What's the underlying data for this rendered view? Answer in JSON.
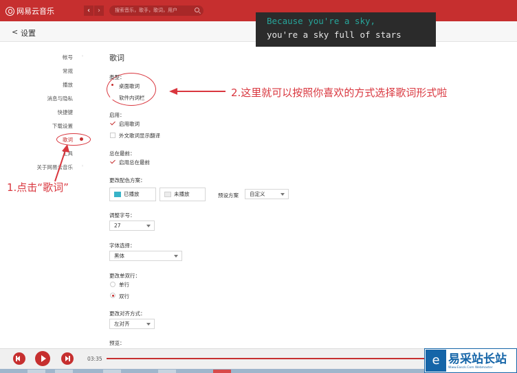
{
  "app": {
    "name": "网易云音乐",
    "search_placeholder": "搜索音乐，歌手，歌词，用户"
  },
  "overlay_lyrics": {
    "line1": "Because you're a sky,",
    "line2": "you're a sky full of stars"
  },
  "header": {
    "back_glyph": "<",
    "title": "设置"
  },
  "sidebar": {
    "items": [
      {
        "label": "帐号",
        "selected": false
      },
      {
        "label": "常规",
        "selected": false
      },
      {
        "label": "播放",
        "selected": false
      },
      {
        "label": "消息与隐私",
        "selected": false
      },
      {
        "label": "快捷键",
        "selected": false
      },
      {
        "label": "下载设置",
        "selected": false
      },
      {
        "label": "歌词",
        "selected": true
      },
      {
        "label": "工具",
        "selected": false
      },
      {
        "label": "关于网易云音乐",
        "selected": false
      }
    ]
  },
  "lyrics_settings": {
    "heading": "歌词",
    "type": {
      "label": "类型：",
      "options": [
        {
          "label": "桌面歌词",
          "selected": true
        },
        {
          "label": "软件内词栏",
          "selected": false
        }
      ]
    },
    "enable": {
      "label": "启用：",
      "options": [
        {
          "label": "启用歌词",
          "checked": true
        },
        {
          "label": "外文歌词显示翻译",
          "checked": false
        }
      ]
    },
    "always_on_top": {
      "label": "总在最前：",
      "option": {
        "label": "启用总在最前",
        "checked": true
      }
    },
    "color_scheme": {
      "label": "更改配色方案：",
      "played": "已播放",
      "unplayed": "未播放",
      "preset_label": "预设方案",
      "preset_value": "自定义",
      "played_color": "#37b3c8",
      "unplayed_color": "#ececec"
    },
    "font_size": {
      "label": "调整字号：",
      "value": "27"
    },
    "font": {
      "label": "字体选择：",
      "value": "黑体"
    },
    "line_mode": {
      "label": "更改单双行：",
      "options": [
        {
          "label": "单行",
          "selected": false
        },
        {
          "label": "双行",
          "selected": true
        }
      ]
    },
    "align": {
      "label": "更改对齐方式：",
      "value": "左对齐"
    },
    "preview": {
      "label": "预览："
    }
  },
  "annotations": {
    "left_note": "1.点击“歌词”",
    "right_note": "2.这里就可以按照你喜欢的方式选择歌词形式啦",
    "color": "#d9363e"
  },
  "player": {
    "elapsed": "03:35",
    "progress": 0.99
  },
  "watermark": {
    "glyph": "e",
    "title": "易采站长站",
    "subtitle": "Www.Easck.Com Webmaster"
  },
  "colors": {
    "brand": "#c62f2f"
  }
}
